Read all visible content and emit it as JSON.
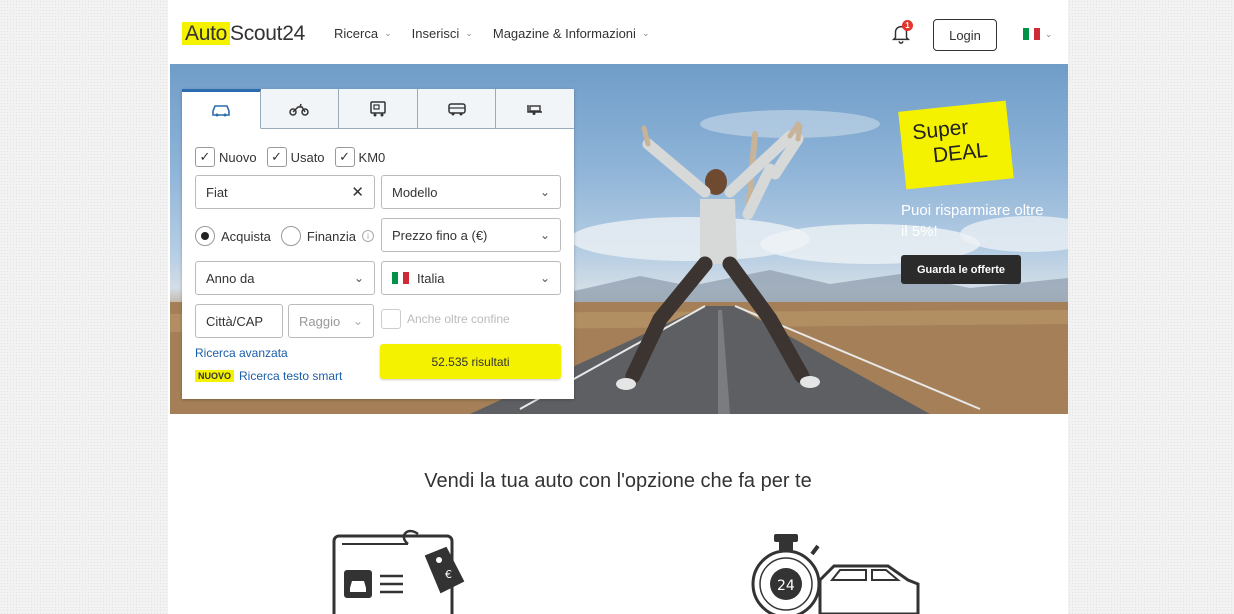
{
  "header": {
    "logo_auto": "Auto",
    "logo_rest": "Scout24",
    "nav": [
      {
        "label": "Ricerca"
      },
      {
        "label": "Inserisci"
      },
      {
        "label": "Magazine & Informazioni"
      }
    ],
    "notification_count": "1",
    "login_label": "Login"
  },
  "search": {
    "tabs": [
      "car-icon",
      "motorbike-icon",
      "camper-icon",
      "van-icon",
      "trailer-icon"
    ],
    "checks": [
      {
        "label": "Nuovo",
        "checked": true
      },
      {
        "label": "Usato",
        "checked": true
      },
      {
        "label": "KM0",
        "checked": true
      }
    ],
    "make_value": "Fiat",
    "model_placeholder": "Modello",
    "radio_buy": "Acquista",
    "radio_finance": "Finanzia",
    "price_placeholder": "Prezzo fino a (€)",
    "year_placeholder": "Anno da",
    "country_value": "Italia",
    "city_placeholder": "Città/CAP",
    "radius_placeholder": "Raggio",
    "cross_border_label": "Anche oltre confine",
    "advanced_link": "Ricerca avanzata",
    "new_badge": "NUOVO",
    "smart_link": "Ricerca testo smart",
    "results_label": "52.535 risultati"
  },
  "promo": {
    "line1": "Super",
    "line2": "DEAL",
    "text": "Puoi risparmiare oltre il 5%!",
    "button_label": "Guarda le offerte"
  },
  "sell": {
    "title": "Vendi la tua auto con l'opzione che fa per te",
    "stopwatch_number": "24"
  },
  "colors": {
    "brand_yellow": "#f5f200",
    "link_blue": "#1c5ea8",
    "dark": "#2b2b2b"
  }
}
